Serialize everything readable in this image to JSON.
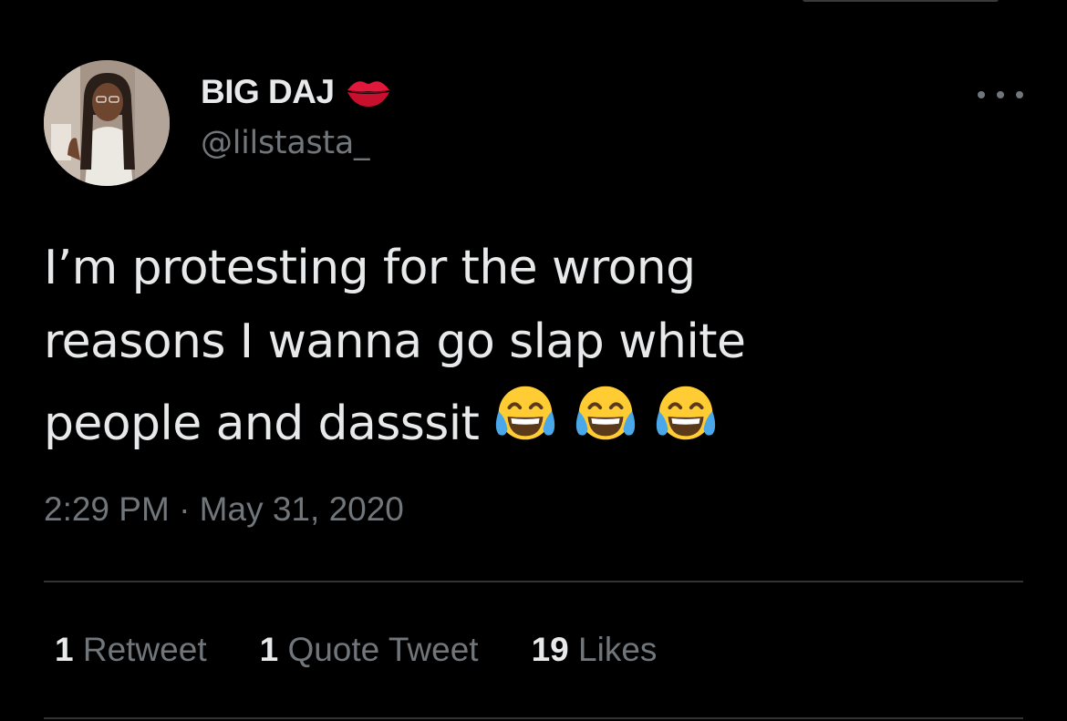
{
  "author": {
    "display_name": "BIG DAJ",
    "handle": "@lilstasta_",
    "badge_icon": "kiss-mark-icon"
  },
  "tweet": {
    "lines": [
      "I’m protesting for the wrong",
      "reasons I wanna go slap white",
      "people and dasssit"
    ],
    "emojis": [
      "face-with-tears-of-joy-icon",
      "face-with-tears-of-joy-icon",
      "face-with-tears-of-joy-icon"
    ],
    "timestamp": "2:29 PM · May 31, 2020"
  },
  "stats": {
    "retweets": {
      "count": "1",
      "label": "Retweet"
    },
    "quotes": {
      "count": "1",
      "label": "Quote Tweet"
    },
    "likes": {
      "count": "19",
      "label": "Likes"
    }
  },
  "colors": {
    "background": "#000000",
    "primary_text": "#e7e9ea",
    "secondary_text": "#71767b",
    "divider": "#2f3336",
    "lips": "#e0183c"
  }
}
